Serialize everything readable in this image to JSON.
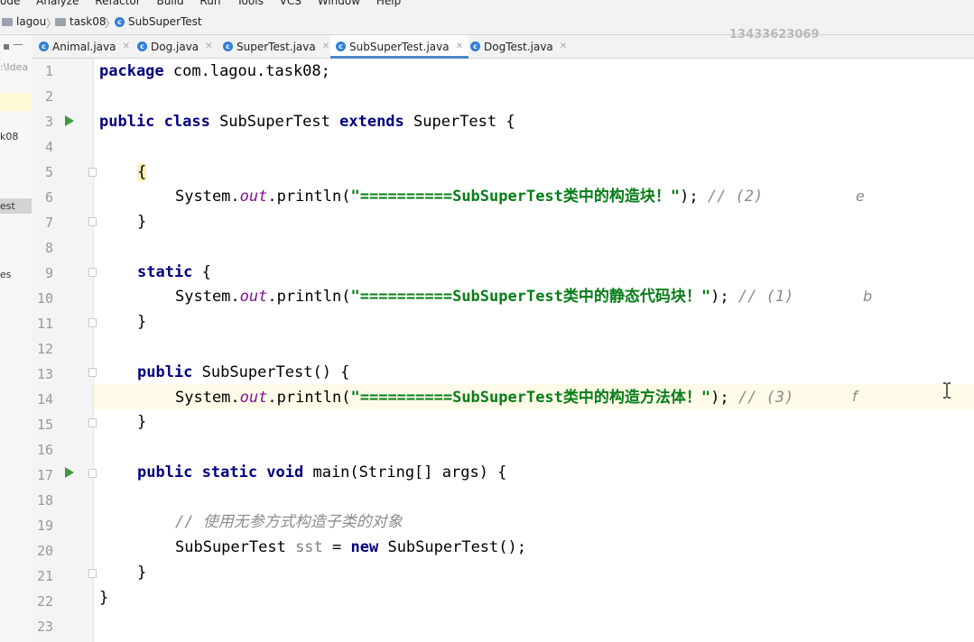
{
  "menu": [
    "ode",
    "Analyze",
    "Refactor",
    "Build",
    "Run",
    "Tools",
    "VCS",
    "Window",
    "Help"
  ],
  "breadcrumb": [
    {
      "label": "lagou",
      "icon": "folder-icon"
    },
    {
      "label": "task08",
      "icon": "folder-icon"
    },
    {
      "label": "SubSuperTest",
      "icon": "class-icon"
    }
  ],
  "watermark": "13433623069",
  "sidebar": {
    "path_fragment": ":\\Idea",
    "items": [
      "k08",
      "est",
      "es"
    ]
  },
  "tabs": [
    {
      "label": "Animal.java",
      "active": false
    },
    {
      "label": "Dog.java",
      "active": false
    },
    {
      "label": "SuperTest.java",
      "active": false
    },
    {
      "label": "SubSuperTest.java",
      "active": true
    },
    {
      "label": "DogTest.java",
      "active": false
    }
  ],
  "line_numbers": [
    "1",
    "2",
    "3",
    "4",
    "5",
    "6",
    "7",
    "8",
    "9",
    "10",
    "11",
    "12",
    "13",
    "14",
    "15",
    "16",
    "17",
    "18",
    "19",
    "20",
    "21",
    "22",
    "23"
  ],
  "code": {
    "l1_kw": "package",
    "l1_rest": " com.lagou.task08;",
    "l3_kw1": "public class",
    "l3_name": " SubSuperTest ",
    "l3_kw2": "extends",
    "l3_rest": " SuperTest {",
    "brace_open": "{",
    "brace_close": "}",
    "sys": "System.",
    "out": "out",
    "println": ".println(",
    "str1": "\"==========SubSuperTest类中的构造块！\"",
    "end": ");",
    "cmt1": " // (2)",
    "static_kw": "static",
    "static_rest": " {",
    "str2": "\"==========SubSuperTest类中的静态代码块！\"",
    "cmt2": " // (1)",
    "l13_kw": "public",
    "l13_rest": " SubSuperTest() {",
    "str3": "\"==========SubSuperTest类中的构造方法体！\"",
    "cmt3": " // (3)",
    "l17_kw": "public static void",
    "l17_rest": " main(String[] args) {",
    "l19_cmt": "// 使用无参方式构造子类的对象",
    "l20_a": "SubSuperTest ",
    "l20_var": "sst",
    "l20_b": " = ",
    "l20_kw": "new",
    "l20_c": " SubSuperTest();",
    "class_close": "}"
  },
  "notes": {
    "line6": "e",
    "line10": "b",
    "line14": "f"
  }
}
